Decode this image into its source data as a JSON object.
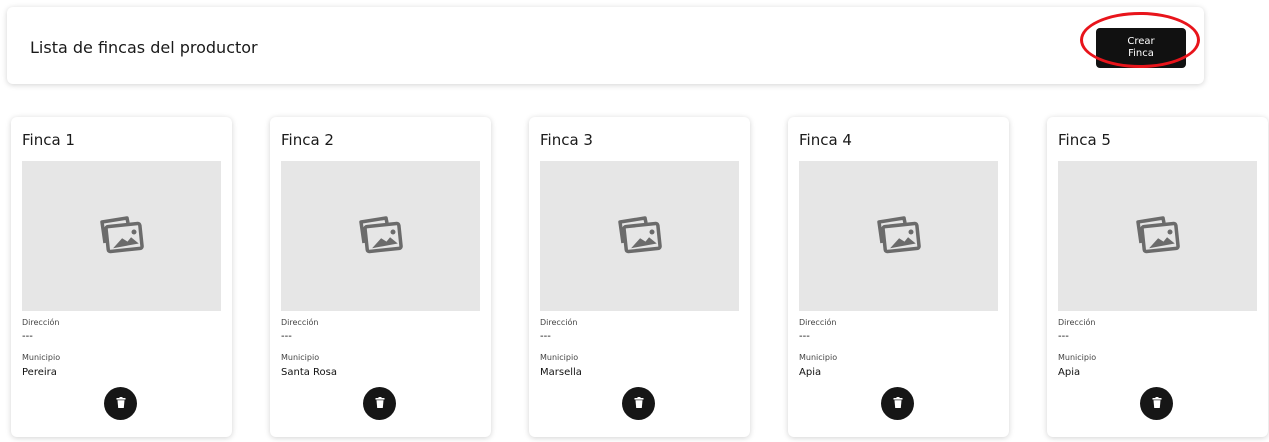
{
  "header": {
    "title": "Lista de fincas del productor",
    "create_button": {
      "line1": "Crear",
      "line2": "Finca"
    }
  },
  "cards": [
    {
      "title": "Finca 1",
      "direccion_label": "Dirección",
      "direccion": "---",
      "municipio_label": "Municipio",
      "municipio": "Pereira"
    },
    {
      "title": "Finca 2",
      "direccion_label": "Dirección",
      "direccion": "---",
      "municipio_label": "Municipio",
      "municipio": "Santa Rosa"
    },
    {
      "title": "Finca 3",
      "direccion_label": "Dirección",
      "direccion": "---",
      "municipio_label": "Municipio",
      "municipio": "Marsella"
    },
    {
      "title": "Finca 4",
      "direccion_label": "Dirección",
      "direccion": "---",
      "municipio_label": "Municipio",
      "municipio": "Apia"
    },
    {
      "title": "Finca 5",
      "direccion_label": "Dirección",
      "direccion": "---",
      "municipio_label": "Municipio",
      "municipio": "Apia"
    }
  ],
  "icons": {
    "image_placeholder": "image-icon",
    "delete": "trash-icon"
  },
  "colors": {
    "accent": "#111111",
    "highlight": "#e8141b",
    "placeholder_bg": "#e6e6e6"
  }
}
